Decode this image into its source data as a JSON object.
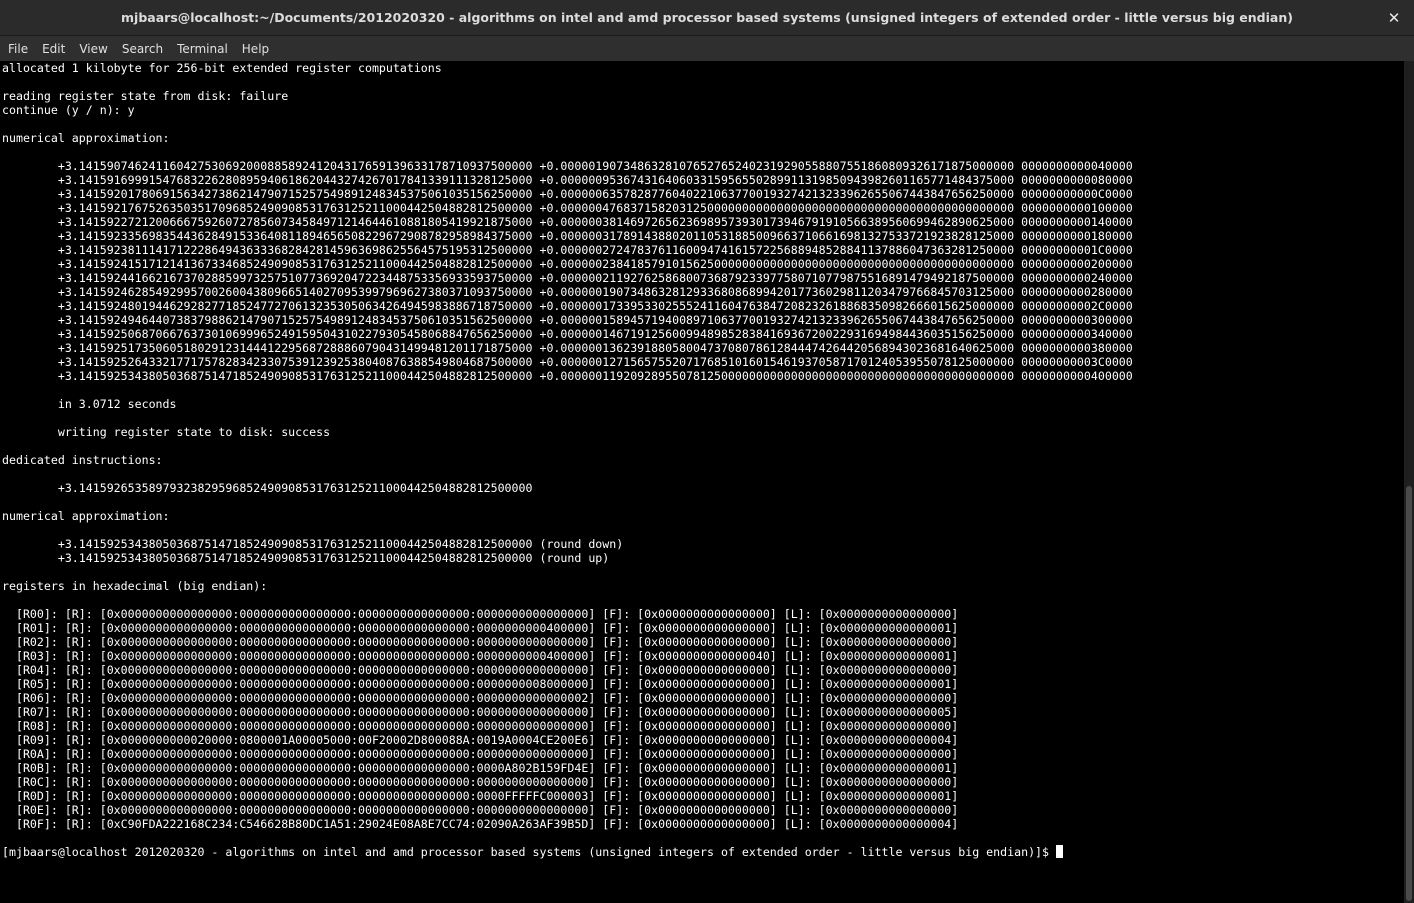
{
  "window": {
    "title": "mjbaars@localhost:~/Documents/2012020320 - algorithms on intel and amd processor based systems (unsigned integers of extended order - little versus big endian)",
    "close_glyph": "✕"
  },
  "menu": [
    "File",
    "Edit",
    "View",
    "Search",
    "Terminal",
    "Help"
  ],
  "terminal": {
    "lines": [
      "allocated 1 kilobyte for 256-bit extended register computations",
      "",
      "reading register state from disk: failure",
      "continue (y / n): y",
      "",
      "numerical approximation:",
      "",
      "        +3.14159074624116042753069200088589241204317659139633178710937500000 +0.00000190734863281076527652402319290558807551860809326171875000000 0000000000040000",
      "        +3.14159169991547683226280895940618620443274267017841339111328125000 +0.00000095367431640603315956550289911319850943982601165771484375000 0000000000080000",
      "        +3.14159201780691563427386214790715257549891248345375061035156250000 +0.00000063578287760402210637700193274213233962655067443847656250000 00000000000C0000",
      "        +3.14159217675263503517096852490908531763125211000442504882812500000 +0.00000047683715820312500000000000000000000000000000000000000000000 0000000000100000",
      "        +3.14159227212006667592607278560734584971214644610881805419921875000 +0.00000038146972656236989573930173946791910566389560699462890625000 0000000000140000",
      "        +3.14159233569835443628491533640811894656508229672908782958984375000 +0.00000031789143880201105318850096637106616981327533721923828125000 0000000000180000",
      "        +3.14159238111417122286494363336828428145963698625564575195312500000 +0.00000027247837611600947416157225688948528841137886047363281250000 00000000001C0000",
      "        +3.14159241517121413673346852490908531763125211000442504882812500000 +0.00000023841857910156250000000000000000000000000000000000000000000 0000000000200000",
      "        +3.14159244166216737028859973257510773692047223448753356933593750000 +0.00000021192762586800736879233977580710779875516891479492187500000 0000000000240000",
      "        +3.14159246285492995700260043809665140270953997969627380371093750000 +0.00000019073486328129336808689942017736029811203479766845703125000 0000000000280000",
      "        +3.14159248019446292827718524772706132353050634264945983886718750000 +0.00000017339533025552411604763847208232618868350982666015625000000 00000000002C0000",
      "        +3.14159249464407383798862147907152575498912483453750610351562500000 +0.00000015894571940089710637700193274213233962655067443847656250000 0000000000300000",
      "        +3.14159250687066763730106999652491595043102279305458068847656250000 +0.00000014671912560099489852838416936720022931694984436035156250000 0000000000340000",
      "        +3.14159251735060518029123144412295687288860790431499481201171875000 +0.00000013623918805800473708078612844474264420568943023681640625000 0000000000380000",
      "        +3.14159252643321771757828342330753912392538040876388549804687500000 +0.00000012715657552071768510160154619370587170124053955078125000000 00000000003C0000",
      "        +3.14159253438050368751471852490908531763125211000442504882812500000 +0.00000011920928955078125000000000000000000000000000000000000000000 0000000000400000",
      "",
      "        in 3.0712 seconds",
      "",
      "        writing register state to disk: success",
      "",
      "dedicated instructions:",
      "",
      "        +3.14159265358979323829596852490908531763125211000442504882812500000",
      "",
      "numerical approximation:",
      "",
      "        +3.14159253438050368751471852490908531763125211000442504882812500000 (round down)",
      "        +3.14159253438050368751471852490908531763125211000442504882812500000 (round up)",
      "",
      "registers in hexadecimal (big endian):",
      "",
      "  [R00]: [R]: [0x0000000000000000:0000000000000000:0000000000000000:0000000000000000] [F]: [0x0000000000000000] [L]: [0x0000000000000000]",
      "  [R01]: [R]: [0x0000000000000000:0000000000000000:0000000000000000:0000000000400000] [F]: [0x0000000000000000] [L]: [0x0000000000000001]",
      "  [R02]: [R]: [0x0000000000000000:0000000000000000:0000000000000000:0000000000000000] [F]: [0x0000000000000000] [L]: [0x0000000000000000]",
      "  [R03]: [R]: [0x0000000000000000:0000000000000000:0000000000000000:0000000000400000] [F]: [0x0000000000000040] [L]: [0x0000000000000001]",
      "  [R04]: [R]: [0x0000000000000000:0000000000000000:0000000000000000:0000000000000000] [F]: [0x0000000000000000] [L]: [0x0000000000000000]",
      "  [R05]: [R]: [0x0000000000000000:0000000000000000:0000000000000000:0000000008000000] [F]: [0x0000000000000000] [L]: [0x0000000000000001]",
      "  [R06]: [R]: [0x0000000000000000:0000000000000000:0000000000000000:0000000000000002] [F]: [0x0000000000000000] [L]: [0x0000000000000000]",
      "  [R07]: [R]: [0x0000000000000000:0000000000000000:0000000000000000:0000000000000000] [F]: [0x0000000000000000] [L]: [0x0000000000000005]",
      "  [R08]: [R]: [0x0000000000000000:0000000000000000:0000000000000000:0000000000000000] [F]: [0x0000000000000000] [L]: [0x0000000000000000]",
      "  [R09]: [R]: [0x0000000000020000:0800001A00005000:00F20002D800088A:0019A0004CE200E6] [F]: [0x0000000000000000] [L]: [0x0000000000000004]",
      "  [R0A]: [R]: [0x0000000000000000:0000000000000000:0000000000000000:0000000000000000] [F]: [0x0000000000000000] [L]: [0x0000000000000000]",
      "  [R0B]: [R]: [0x0000000000000000:0000000000000000:0000000000000000:0000A802B159FD4E] [F]: [0x0000000000000000] [L]: [0x0000000000000001]",
      "  [R0C]: [R]: [0x0000000000000000:0000000000000000:0000000000000000:0000000000000000] [F]: [0x0000000000000000] [L]: [0x0000000000000000]",
      "  [R0D]: [R]: [0x0000000000000000:0000000000000000:0000000000000000:0000FFFFFC000003] [F]: [0x0000000000000000] [L]: [0x0000000000000001]",
      "  [R0E]: [R]: [0x0000000000000000:0000000000000000:0000000000000000:0000000000000000] [F]: [0x0000000000000000] [L]: [0x0000000000000000]",
      "  [R0F]: [R]: [0xC90FDA222168C234:C546628B80DC1A51:29024E08A8E7CC74:02090A263AF39B5D] [F]: [0x0000000000000000] [L]: [0x0000000000000004]",
      ""
    ],
    "prompt": "[mjbaars@localhost 2012020320 - algorithms on intel and amd processor based systems (unsigned integers of extended order - little versus big endian)]$ "
  }
}
